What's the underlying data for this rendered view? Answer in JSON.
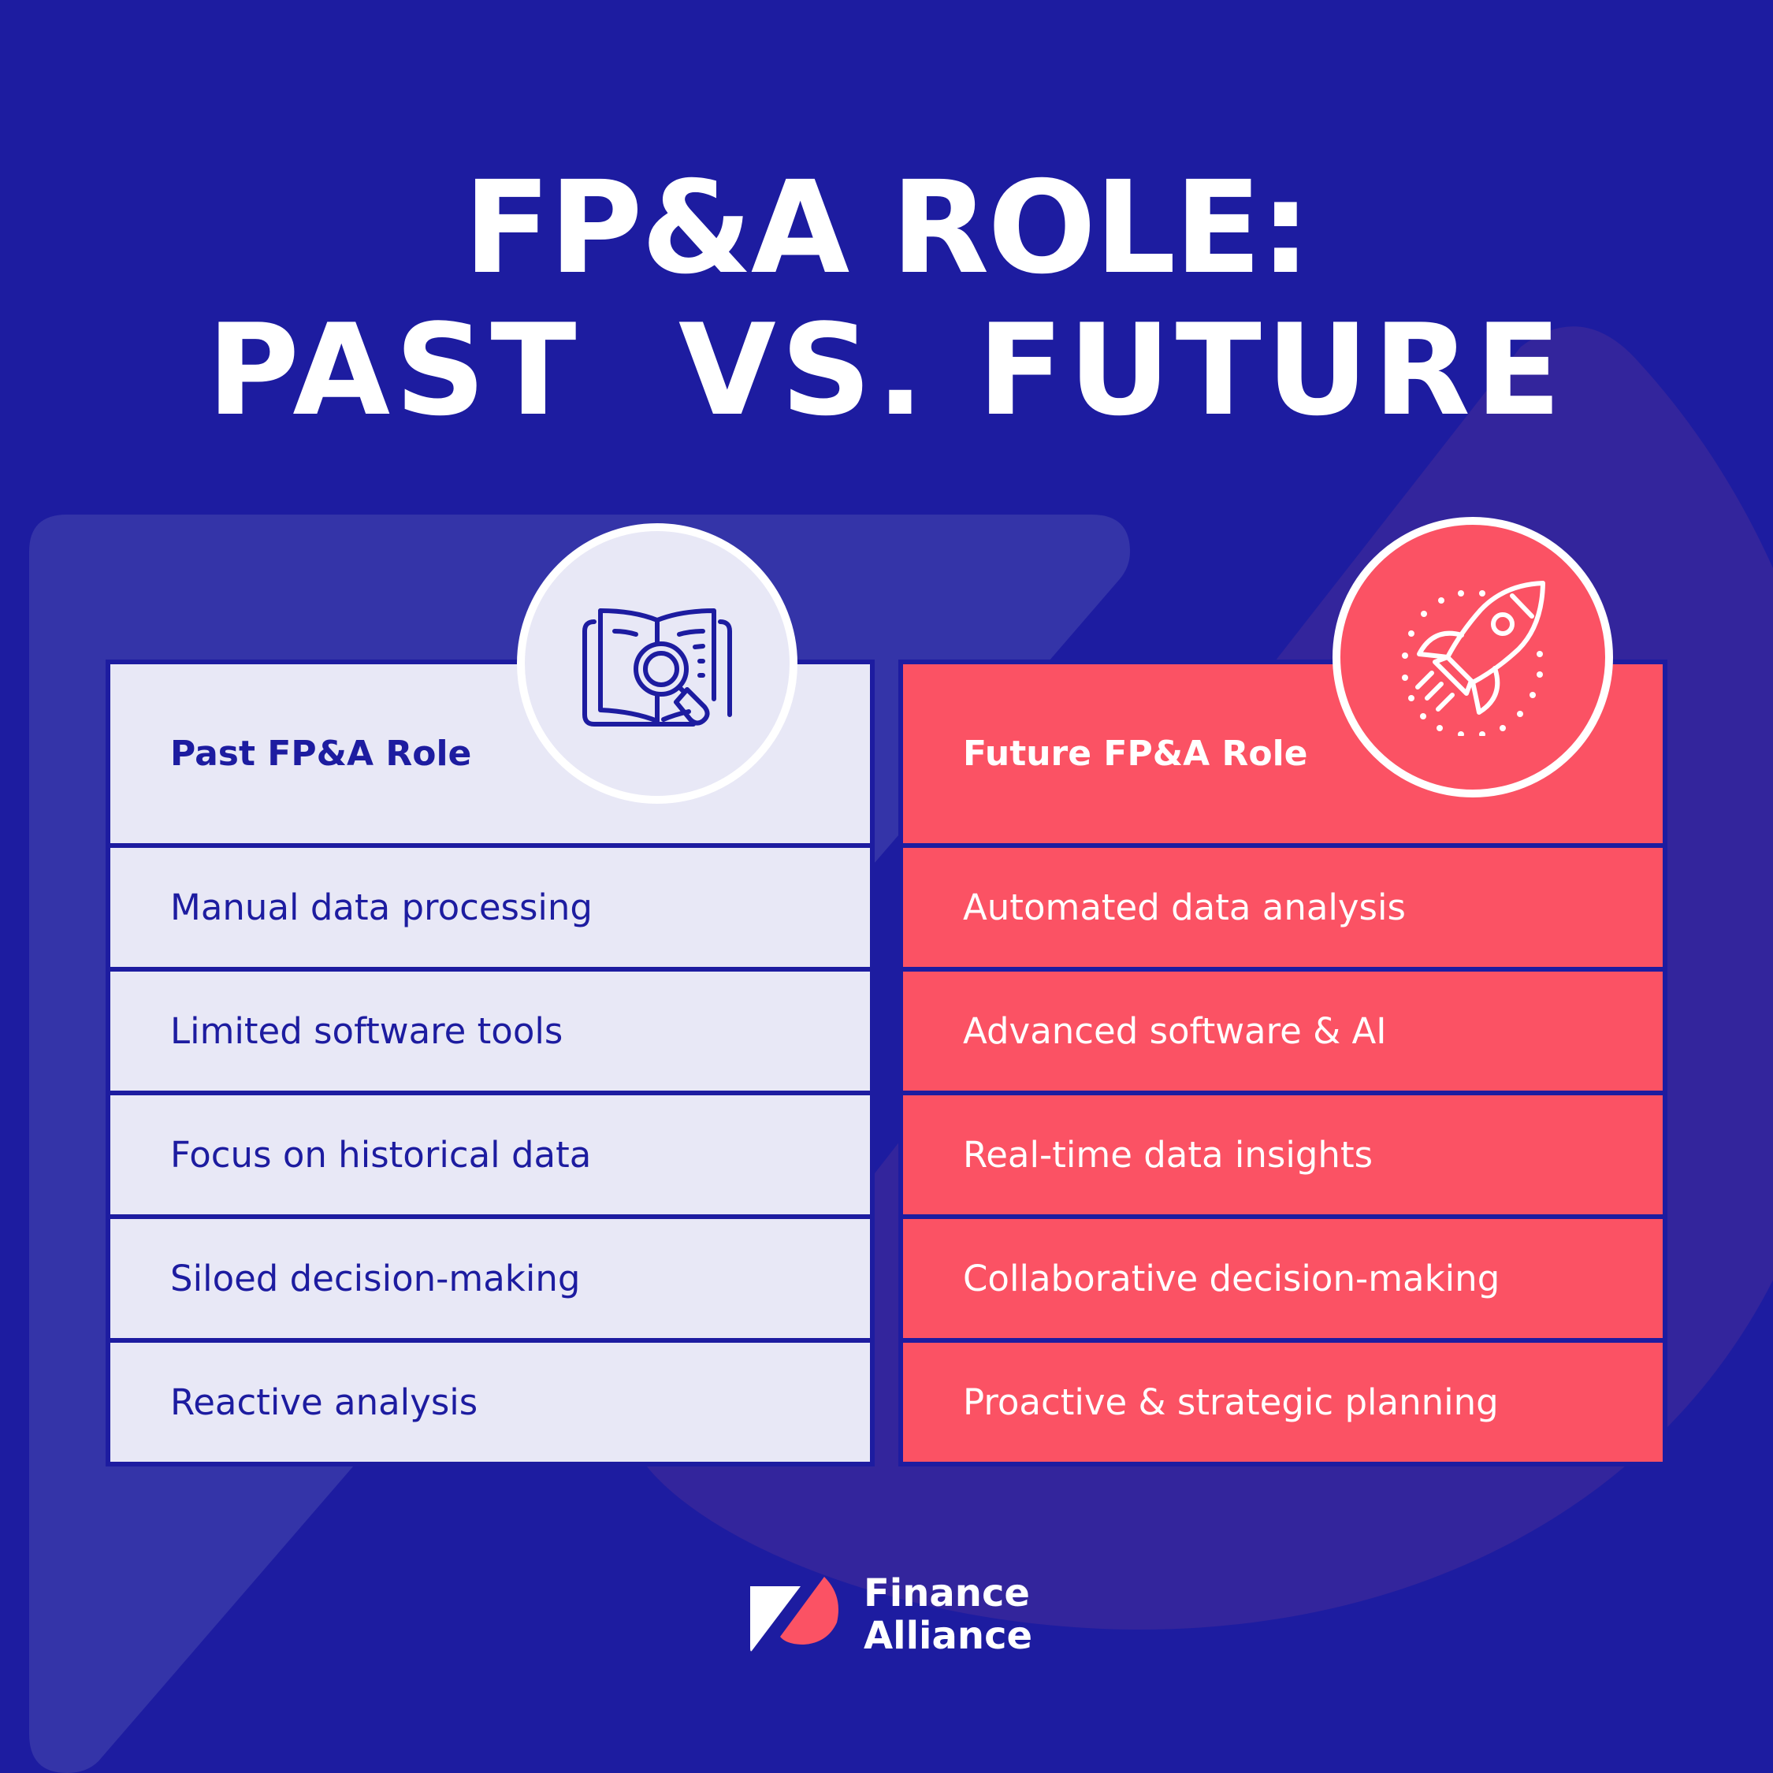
{
  "title": {
    "line1": "FP&A ROLE:",
    "line2": "PAST  VS. FUTURE"
  },
  "colors": {
    "background": "#1D1CA0",
    "past_fill": "#E8E8F6",
    "past_text": "#1D1CA0",
    "future_fill": "#FB5264",
    "future_text": "#FFFFFF",
    "accent_shape_light": "#3434A8",
    "accent_shape_purple": "#33259C"
  },
  "past": {
    "icon": "book-magnifier-icon",
    "header": "Past FP&A Role",
    "items": [
      "Manual data processing",
      "Limited software tools",
      "Focus on historical data",
      "Siloed decision-making",
      "Reactive analysis"
    ]
  },
  "future": {
    "icon": "rocket-icon",
    "header": "Future FP&A Role",
    "items": [
      "Automated data analysis",
      "Advanced software & AI",
      "Real-time data insights",
      "Collaborative decision-making",
      "Proactive & strategic planning"
    ]
  },
  "brand": {
    "line1": "Finance",
    "line2": "Alliance",
    "icon": "finance-alliance-logo-icon"
  }
}
